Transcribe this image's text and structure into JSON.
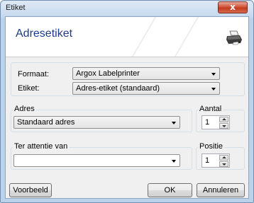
{
  "window": {
    "title": "Etiket",
    "close_glyph": "x"
  },
  "banner": {
    "title": "Adresetiket",
    "icon": "printer-icon"
  },
  "format_group": {
    "formaat_label": "Formaat:",
    "formaat_value": "Argox Labelprinter",
    "etiket_label": "Etiket:",
    "etiket_value": "Adres-etiket (standaard)"
  },
  "adres": {
    "label": "Adres",
    "value": "Standaard adres"
  },
  "aantal": {
    "label": "Aantal",
    "value": "1"
  },
  "ter_attentie": {
    "label": "Ter attentie van",
    "value": ""
  },
  "positie": {
    "label": "Positie",
    "value": "1"
  },
  "buttons": {
    "preview": "Voorbeeld",
    "ok": "OK",
    "cancel": "Annuleren"
  },
  "colors": {
    "title_blue": "#1e3a8a",
    "close_red": "#c23a20"
  }
}
